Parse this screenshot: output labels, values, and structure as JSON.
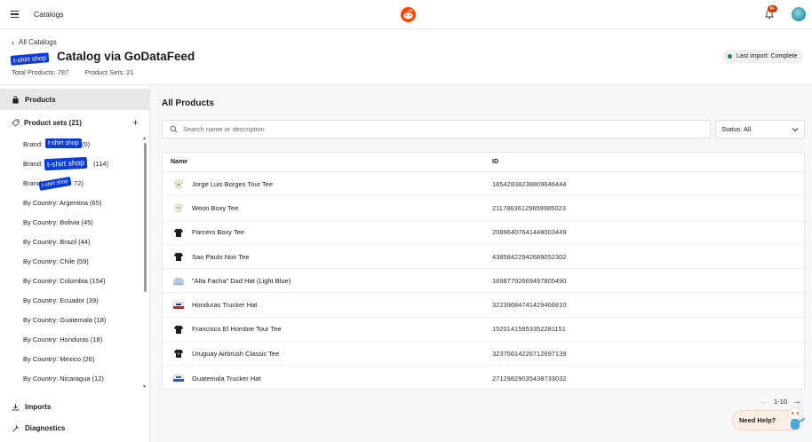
{
  "topbar": {
    "title": "Catalogs",
    "notification_count": "9+"
  },
  "header": {
    "back_label": "All Catalogs",
    "title": "Catalog via GoDataFeed",
    "title_tag": "t-shirt shop",
    "total_products": "Total Products: 787",
    "product_sets": "Product Sets: 21",
    "import_status": "Last import: Complete"
  },
  "sidebar": {
    "products_label": "Products",
    "product_sets_label": "Product sets (21)",
    "sets": [
      {
        "label": "Brand:",
        "tag": "t-shirt shop",
        "suffix": "(0)"
      },
      {
        "label": "Brand:",
        "tag": "t-shirt shop",
        "suffix": "(114)"
      },
      {
        "label": "Brand",
        "tag": "t-shirt shop",
        "suffix": "72)"
      },
      {
        "label": "By Country: Argentina (65)"
      },
      {
        "label": "By Country: Bolivia (45)"
      },
      {
        "label": "By Country: Brazil (44)"
      },
      {
        "label": "By Country: Chile (59)"
      },
      {
        "label": "By Country: Colombia (154)"
      },
      {
        "label": "By Country: Ecuador (39)"
      },
      {
        "label": "By Country: Guatemala (18)"
      },
      {
        "label": "By Country: Honduras (18)"
      },
      {
        "label": "By Country: Mexico (26)"
      },
      {
        "label": "By Country: Nicaragua (12)"
      }
    ],
    "imports_label": "Imports",
    "diagnostics_label": "Diagnostics"
  },
  "main": {
    "title": "All Products",
    "search_placeholder": "Search name or description",
    "status_filter": "Status: All",
    "columns": {
      "name": "Name",
      "id": "ID"
    },
    "rows": [
      {
        "name": "Jorge Luis Borges Tour Tee",
        "id": "18542838238809646444",
        "thumb": "cream-tee-icon"
      },
      {
        "name": "Weon Boxy Tee",
        "id": "21178636129659985023",
        "thumb": "cream-tee-icon"
      },
      {
        "name": "Parcero Boxy Tee",
        "id": "20896407641448003449",
        "thumb": "black-tee-icon"
      },
      {
        "name": "Sao Paulo Noir Tee",
        "id": "43858422942689052302",
        "thumb": "black-tee-icon"
      },
      {
        "name": "\"Alta Facha\" Dad Hat (Light Blue)",
        "id": "16987792669497805490",
        "thumb": "blue-hat-icon"
      },
      {
        "name": "Honduras Trucker Hat",
        "id": "32239684741429466810",
        "thumb": "red-trucker-hat-icon"
      },
      {
        "name": "Francisco El Hombre Tour Tee",
        "id": "15201415953352281151",
        "thumb": "black-tee-icon"
      },
      {
        "name": "Uruguay Airbrush Classic Tee",
        "id": "32375614226712697139",
        "thumb": "black-tee-icon"
      },
      {
        "name": "Guatemala Trucker Hat",
        "id": "27129829035438733032",
        "thumb": "blue-trucker-hat-icon"
      }
    ],
    "pagination": "1-10",
    "help_label": "Need Help?"
  }
}
